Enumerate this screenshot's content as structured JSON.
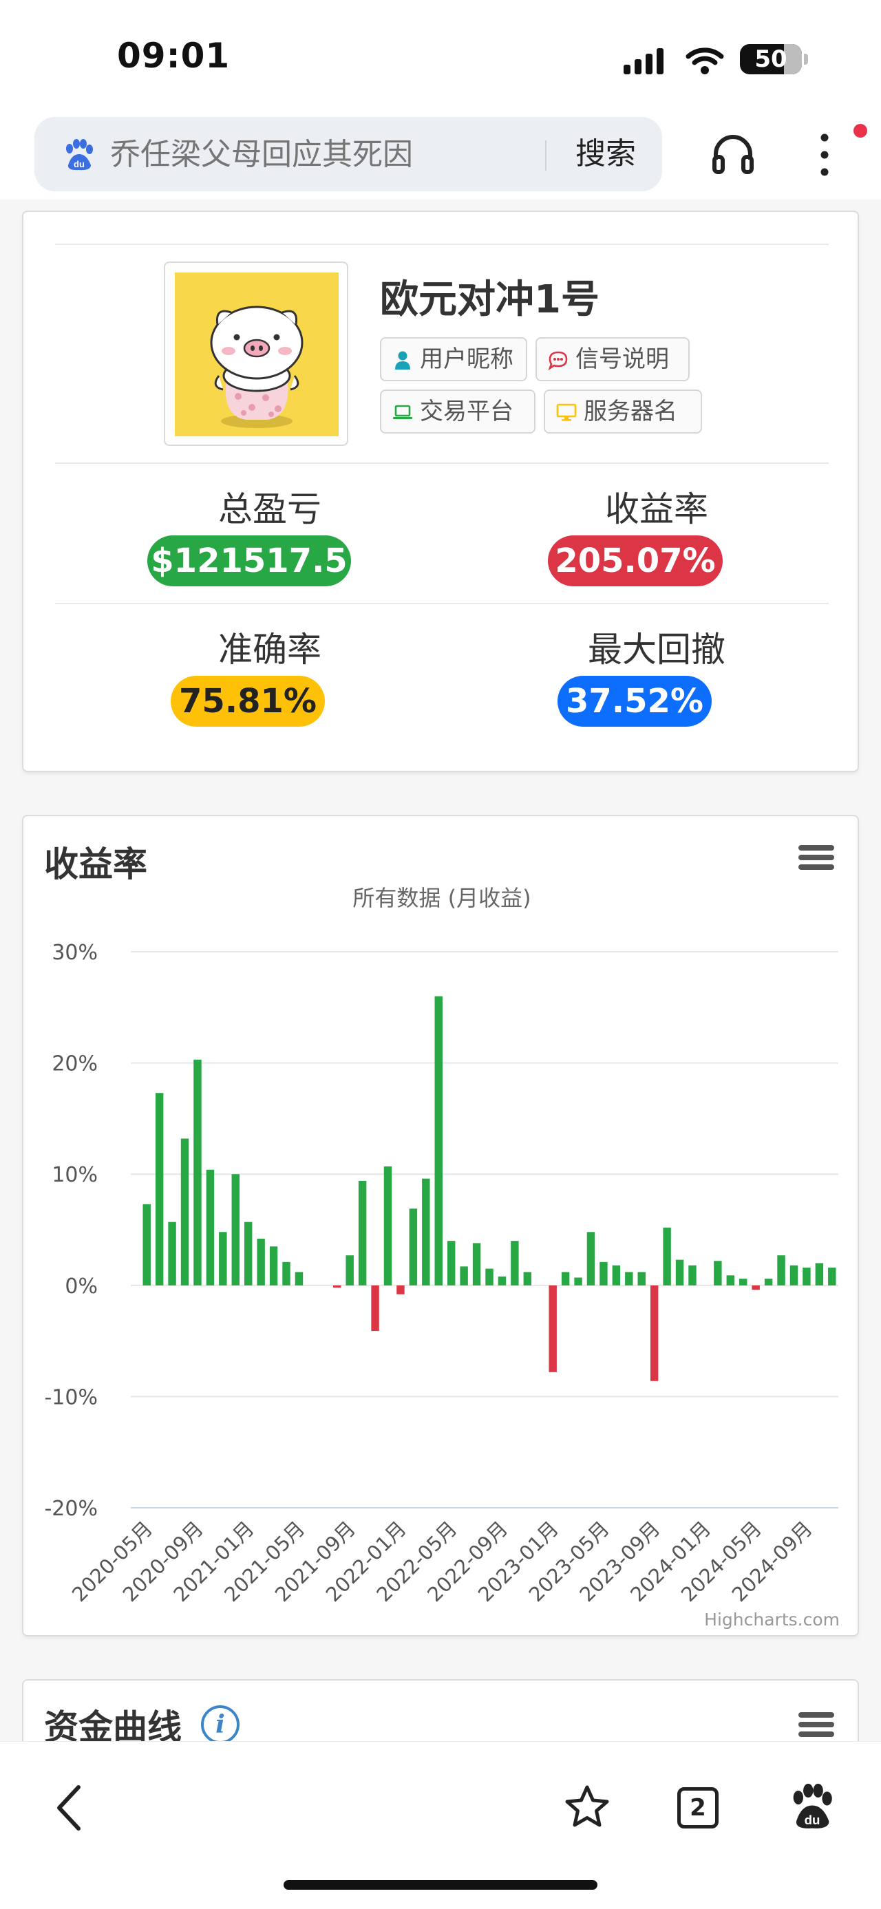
{
  "status_bar": {
    "time": "09:01",
    "battery": "50"
  },
  "browser": {
    "search_placeholder": "乔任梁父母回应其死因",
    "search_button": "搜索"
  },
  "profile": {
    "name": "欧元对冲1号",
    "tags": [
      "用户昵称",
      "信号说明",
      "交易平台",
      "服务器名"
    ],
    "stats": {
      "total_pnl_label": "总盈亏",
      "total_pnl": "$121517.5",
      "return_label": "收益率",
      "return": "205.07%",
      "accuracy_label": "准确率",
      "accuracy": "75.81%",
      "drawdown_label": "最大回撤",
      "drawdown": "37.52%"
    }
  },
  "colors": {
    "positive": "#28a745",
    "negative": "#dc3545",
    "warning": "#ffc107",
    "info": "#0d6efd"
  },
  "chart_card": {
    "title": "收益率",
    "credit": "Highcharts.com"
  },
  "chart_data": {
    "type": "bar",
    "title": "",
    "subtitle": "所有数据 (月收益)",
    "xlabel": "",
    "ylabel": "",
    "ylim": [
      -20,
      30
    ],
    "yticks": [
      "30%",
      "20%",
      "10%",
      "0%",
      "-10%",
      "-20%"
    ],
    "ytick_values": [
      30,
      20,
      10,
      0,
      -10,
      -20
    ],
    "x_tick_labels": [
      "2020-05月",
      "2020-09月",
      "2021-01月",
      "2021-05月",
      "2021-09月",
      "2022-01月",
      "2022-05月",
      "2022-09月",
      "2023-01月",
      "2023-05月",
      "2023-09月",
      "2024-01月",
      "2024-05月",
      "2024-09月"
    ],
    "positive_color": "#28a745",
    "negative_color": "#dc3545",
    "values": [
      7.3,
      17.3,
      5.7,
      13.2,
      20.3,
      10.4,
      4.8,
      10.0,
      5.7,
      4.2,
      3.5,
      2.1,
      1.2,
      null,
      null,
      -0.2,
      2.7,
      9.4,
      -4.1,
      10.7,
      -0.8,
      6.9,
      9.6,
      26.0,
      4.0,
      1.7,
      3.8,
      1.5,
      0.8,
      4.0,
      1.2,
      null,
      -7.8,
      1.2,
      0.7,
      4.8,
      2.1,
      1.8,
      1.2,
      1.2,
      -8.6,
      5.2,
      2.3,
      1.8,
      null,
      2.2,
      0.9,
      0.6,
      -0.4,
      0.6,
      2.7,
      1.8,
      1.6,
      2.0,
      1.6
    ]
  },
  "fund_card": {
    "title": "资金曲线"
  }
}
